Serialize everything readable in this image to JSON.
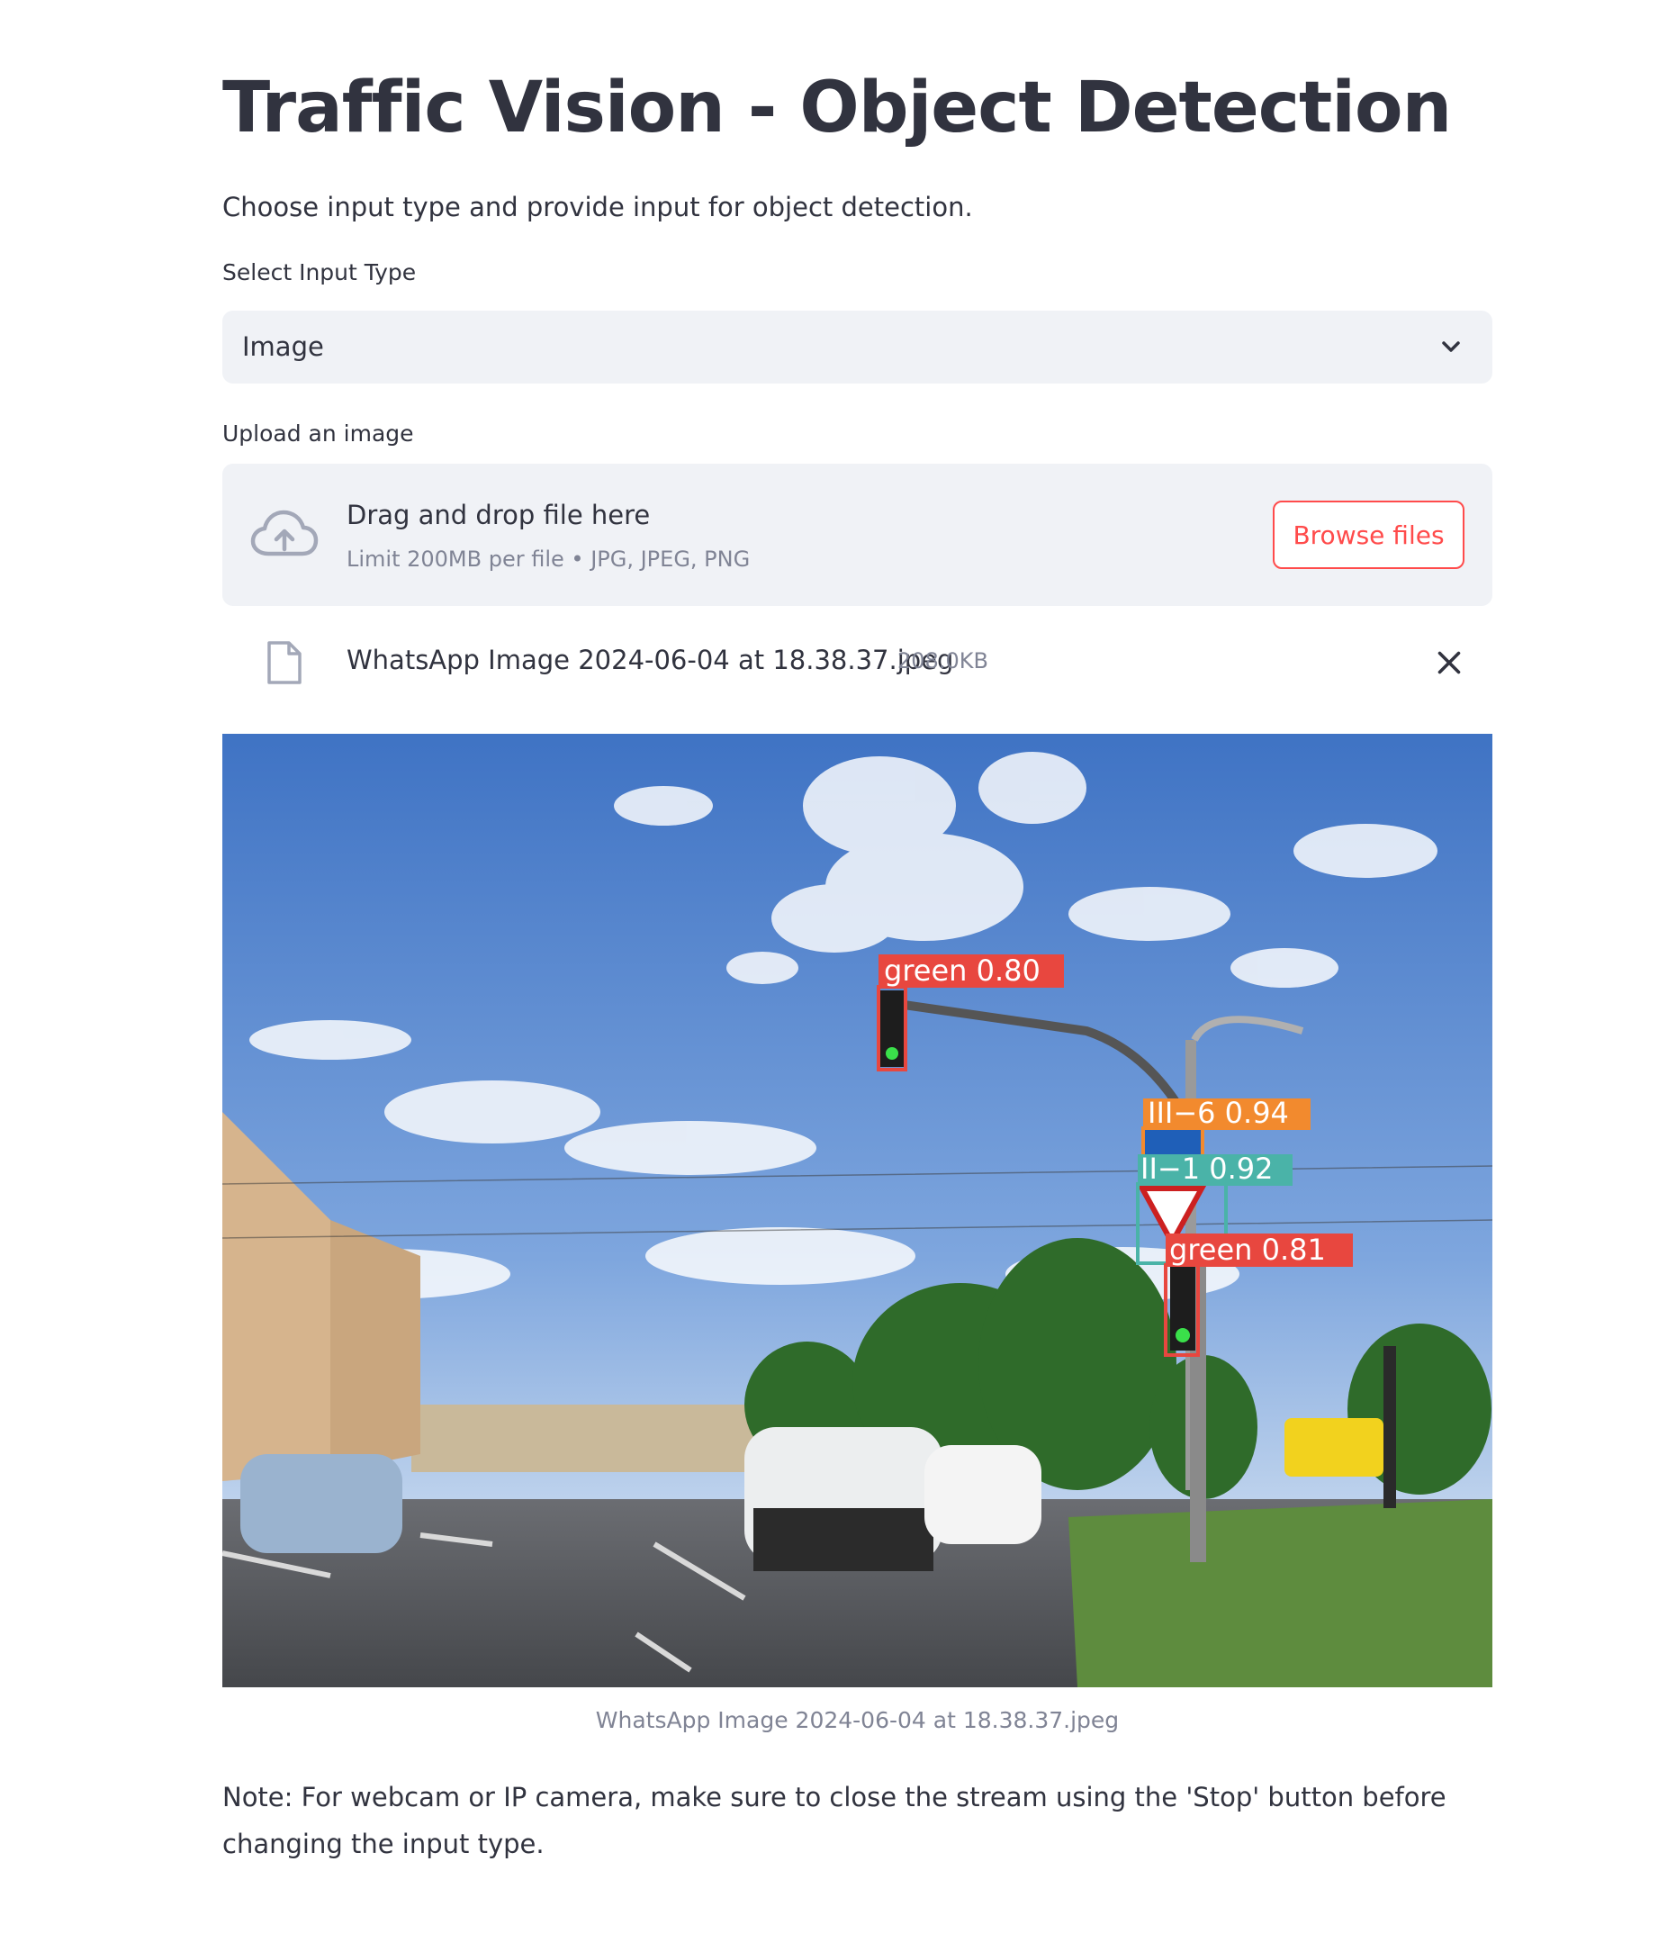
{
  "header": {
    "title": "Traffic Vision - Object Detection"
  },
  "intro_text": "Choose input type and provide input for object detection.",
  "input_type": {
    "label": "Select Input Type",
    "selected": "Image"
  },
  "uploader": {
    "label": "Upload an image",
    "drop_title": "Drag and drop file here",
    "hint": "Limit 200MB per file • JPG, JPEG, PNG",
    "browse_label": "Browse files",
    "file_name": "WhatsApp Image 2024-06-04 at 18.38.37.jpeg",
    "file_size": "208.0KB"
  },
  "result": {
    "caption": "WhatsApp Image 2024-06-04 at 18.38.37.jpeg",
    "detections": [
      {
        "label": "green 0.80",
        "color": "#e8473f"
      },
      {
        "label": "III−6 0.94",
        "color": "#f28a2e"
      },
      {
        "label": "II−1 0.92",
        "color": "#4ab3a8"
      },
      {
        "label": "green 0.81",
        "color": "#e8473f"
      }
    ]
  },
  "note": "Note: For webcam or IP camera, make sure to close the stream using the 'Stop' button before changing the input type.",
  "colors": {
    "accent": "#ff4b4b",
    "text": "#31333f",
    "muted": "#808495",
    "widget_bg": "#f0f2f6"
  }
}
